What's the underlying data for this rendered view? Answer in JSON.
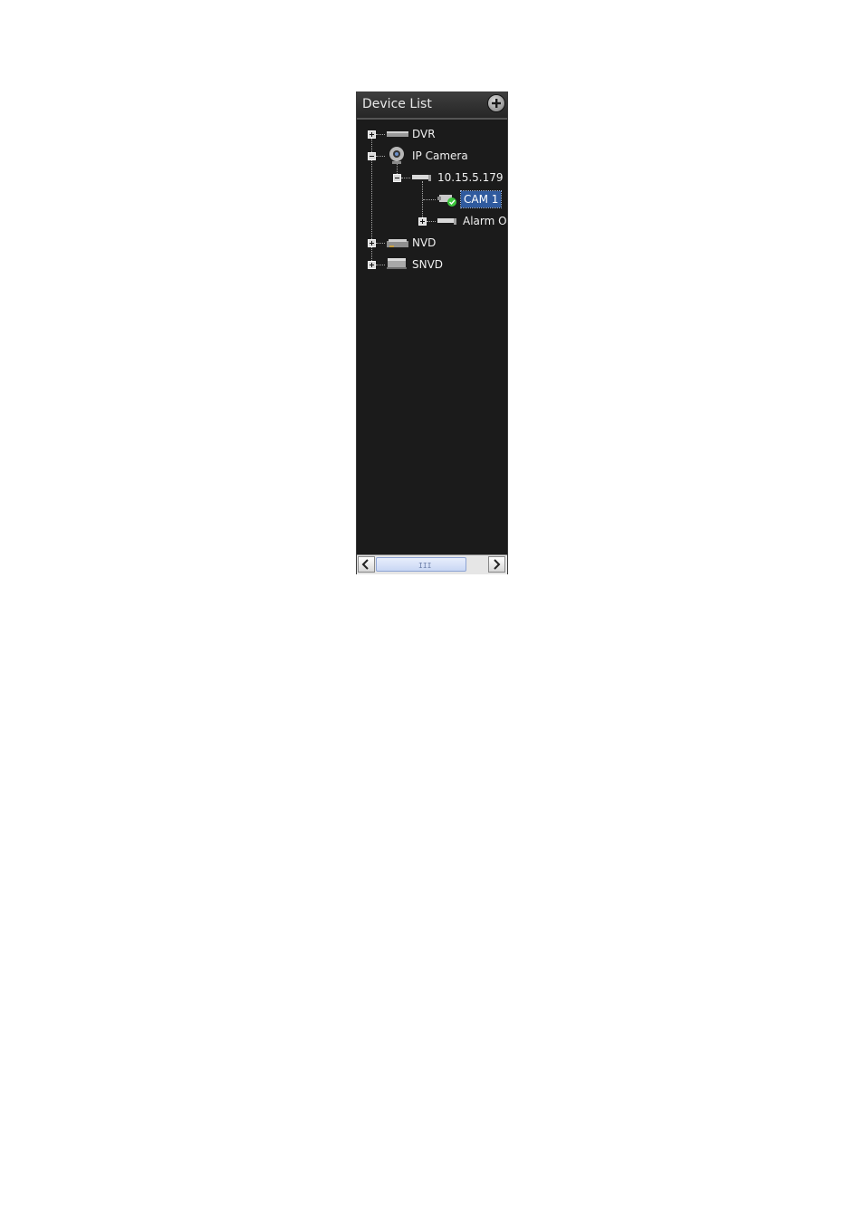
{
  "panel": {
    "title": "Device List",
    "add_icon": "plus-circle-icon"
  },
  "tree": {
    "dvr": {
      "label": "DVR",
      "state": "collapsed"
    },
    "ip_camera": {
      "label": "IP Camera",
      "state": "expanded"
    },
    "ip_address": {
      "label": "10.15.5.179",
      "state": "expanded"
    },
    "cam1": {
      "label": "CAM 1",
      "selected": true
    },
    "alarm_out": {
      "label": "Alarm Out",
      "state": "collapsed"
    },
    "nvd": {
      "label": "NVD",
      "state": "collapsed"
    },
    "snvd": {
      "label": "SNVD",
      "state": "collapsed"
    }
  },
  "scrollbar": {
    "grip": "III",
    "left_icon": "chevron-left-icon",
    "right_icon": "chevron-right-icon"
  },
  "colors": {
    "panel_bg": "#1b1b1b",
    "selection": "#2f5a9e",
    "online_status": "#3cc63c"
  }
}
